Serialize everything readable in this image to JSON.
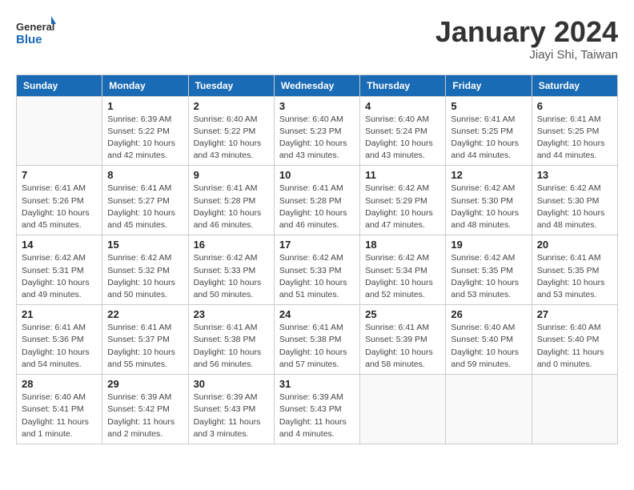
{
  "header": {
    "logo_general": "General",
    "logo_blue": "Blue",
    "month_title": "January 2024",
    "subtitle": "Jiayi Shi, Taiwan"
  },
  "columns": [
    "Sunday",
    "Monday",
    "Tuesday",
    "Wednesday",
    "Thursday",
    "Friday",
    "Saturday"
  ],
  "weeks": [
    [
      {
        "day": "",
        "info": ""
      },
      {
        "day": "1",
        "info": "Sunrise: 6:39 AM\nSunset: 5:22 PM\nDaylight: 10 hours\nand 42 minutes."
      },
      {
        "day": "2",
        "info": "Sunrise: 6:40 AM\nSunset: 5:22 PM\nDaylight: 10 hours\nand 43 minutes."
      },
      {
        "day": "3",
        "info": "Sunrise: 6:40 AM\nSunset: 5:23 PM\nDaylight: 10 hours\nand 43 minutes."
      },
      {
        "day": "4",
        "info": "Sunrise: 6:40 AM\nSunset: 5:24 PM\nDaylight: 10 hours\nand 43 minutes."
      },
      {
        "day": "5",
        "info": "Sunrise: 6:41 AM\nSunset: 5:25 PM\nDaylight: 10 hours\nand 44 minutes."
      },
      {
        "day": "6",
        "info": "Sunrise: 6:41 AM\nSunset: 5:25 PM\nDaylight: 10 hours\nand 44 minutes."
      }
    ],
    [
      {
        "day": "7",
        "info": "Sunrise: 6:41 AM\nSunset: 5:26 PM\nDaylight: 10 hours\nand 45 minutes."
      },
      {
        "day": "8",
        "info": "Sunrise: 6:41 AM\nSunset: 5:27 PM\nDaylight: 10 hours\nand 45 minutes."
      },
      {
        "day": "9",
        "info": "Sunrise: 6:41 AM\nSunset: 5:28 PM\nDaylight: 10 hours\nand 46 minutes."
      },
      {
        "day": "10",
        "info": "Sunrise: 6:41 AM\nSunset: 5:28 PM\nDaylight: 10 hours\nand 46 minutes."
      },
      {
        "day": "11",
        "info": "Sunrise: 6:42 AM\nSunset: 5:29 PM\nDaylight: 10 hours\nand 47 minutes."
      },
      {
        "day": "12",
        "info": "Sunrise: 6:42 AM\nSunset: 5:30 PM\nDaylight: 10 hours\nand 48 minutes."
      },
      {
        "day": "13",
        "info": "Sunrise: 6:42 AM\nSunset: 5:30 PM\nDaylight: 10 hours\nand 48 minutes."
      }
    ],
    [
      {
        "day": "14",
        "info": "Sunrise: 6:42 AM\nSunset: 5:31 PM\nDaylight: 10 hours\nand 49 minutes."
      },
      {
        "day": "15",
        "info": "Sunrise: 6:42 AM\nSunset: 5:32 PM\nDaylight: 10 hours\nand 50 minutes."
      },
      {
        "day": "16",
        "info": "Sunrise: 6:42 AM\nSunset: 5:33 PM\nDaylight: 10 hours\nand 50 minutes."
      },
      {
        "day": "17",
        "info": "Sunrise: 6:42 AM\nSunset: 5:33 PM\nDaylight: 10 hours\nand 51 minutes."
      },
      {
        "day": "18",
        "info": "Sunrise: 6:42 AM\nSunset: 5:34 PM\nDaylight: 10 hours\nand 52 minutes."
      },
      {
        "day": "19",
        "info": "Sunrise: 6:42 AM\nSunset: 5:35 PM\nDaylight: 10 hours\nand 53 minutes."
      },
      {
        "day": "20",
        "info": "Sunrise: 6:41 AM\nSunset: 5:35 PM\nDaylight: 10 hours\nand 53 minutes."
      }
    ],
    [
      {
        "day": "21",
        "info": "Sunrise: 6:41 AM\nSunset: 5:36 PM\nDaylight: 10 hours\nand 54 minutes."
      },
      {
        "day": "22",
        "info": "Sunrise: 6:41 AM\nSunset: 5:37 PM\nDaylight: 10 hours\nand 55 minutes."
      },
      {
        "day": "23",
        "info": "Sunrise: 6:41 AM\nSunset: 5:38 PM\nDaylight: 10 hours\nand 56 minutes."
      },
      {
        "day": "24",
        "info": "Sunrise: 6:41 AM\nSunset: 5:38 PM\nDaylight: 10 hours\nand 57 minutes."
      },
      {
        "day": "25",
        "info": "Sunrise: 6:41 AM\nSunset: 5:39 PM\nDaylight: 10 hours\nand 58 minutes."
      },
      {
        "day": "26",
        "info": "Sunrise: 6:40 AM\nSunset: 5:40 PM\nDaylight: 10 hours\nand 59 minutes."
      },
      {
        "day": "27",
        "info": "Sunrise: 6:40 AM\nSunset: 5:40 PM\nDaylight: 11 hours\nand 0 minutes."
      }
    ],
    [
      {
        "day": "28",
        "info": "Sunrise: 6:40 AM\nSunset: 5:41 PM\nDaylight: 11 hours\nand 1 minute."
      },
      {
        "day": "29",
        "info": "Sunrise: 6:39 AM\nSunset: 5:42 PM\nDaylight: 11 hours\nand 2 minutes."
      },
      {
        "day": "30",
        "info": "Sunrise: 6:39 AM\nSunset: 5:43 PM\nDaylight: 11 hours\nand 3 minutes."
      },
      {
        "day": "31",
        "info": "Sunrise: 6:39 AM\nSunset: 5:43 PM\nDaylight: 11 hours\nand 4 minutes."
      },
      {
        "day": "",
        "info": ""
      },
      {
        "day": "",
        "info": ""
      },
      {
        "day": "",
        "info": ""
      }
    ]
  ]
}
